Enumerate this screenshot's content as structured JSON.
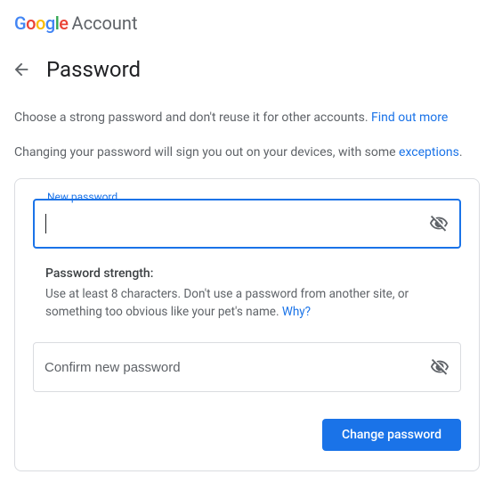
{
  "header": {
    "logo_letters": [
      "G",
      "o",
      "o",
      "g",
      "l",
      "e"
    ],
    "account_label": "Account"
  },
  "page": {
    "title": "Password"
  },
  "intro": {
    "line1_prefix": "Choose a strong password and don't reuse it for other accounts. ",
    "line1_link": "Find out more",
    "line2_prefix": "Changing your password will sign you out on your devices, with some ",
    "line2_link": "exceptions",
    "line2_suffix": "."
  },
  "form": {
    "new_password": {
      "label": "New password",
      "value": ""
    },
    "strength": {
      "title": "Password strength:",
      "body": "Use at least 8 characters. Don't use a password from another site, or something too obvious like your pet's name. ",
      "why_link": "Why?"
    },
    "confirm": {
      "placeholder": "Confirm new password",
      "value": ""
    },
    "submit_label": "Change password"
  }
}
